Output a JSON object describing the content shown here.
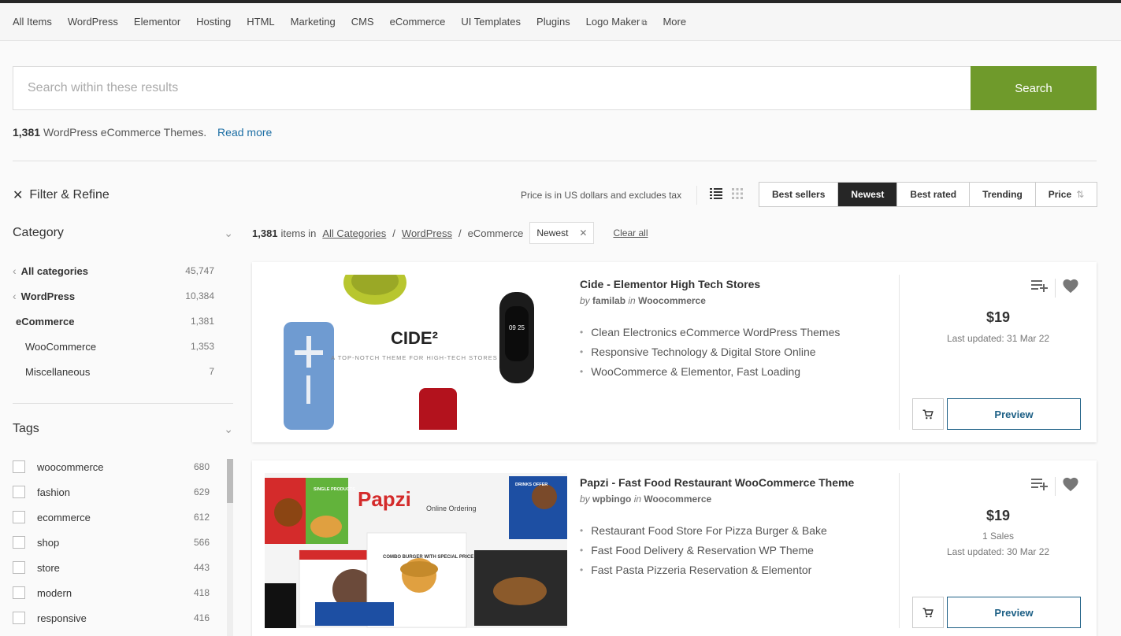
{
  "category_nav": [
    "All Items",
    "WordPress",
    "Elementor",
    "Hosting",
    "HTML",
    "Marketing",
    "CMS",
    "eCommerce",
    "UI Templates",
    "Plugins",
    "Logo Maker",
    "More"
  ],
  "search": {
    "placeholder": "Search within these results",
    "button": "Search"
  },
  "summary": {
    "count": "1,381",
    "text": "WordPress eCommerce Themes.",
    "read_more": "Read more"
  },
  "filter_refine": "Filter & Refine",
  "price_note": "Price is in US dollars and excludes tax",
  "sort": [
    "Best sellers",
    "Newest",
    "Best rated",
    "Trending",
    "Price"
  ],
  "sort_active": "Newest",
  "category": {
    "heading": "Category",
    "items": [
      {
        "label": "All categories",
        "count": "45,747"
      },
      {
        "label": "WordPress",
        "count": "10,384"
      },
      {
        "label": "eCommerce",
        "count": "1,381"
      },
      {
        "label": "WooCommerce",
        "count": "1,353"
      },
      {
        "label": "Miscellaneous",
        "count": "7"
      }
    ]
  },
  "tags": {
    "heading": "Tags",
    "items": [
      {
        "label": "woocommerce",
        "count": "680"
      },
      {
        "label": "fashion",
        "count": "629"
      },
      {
        "label": "ecommerce",
        "count": "612"
      },
      {
        "label": "shop",
        "count": "566"
      },
      {
        "label": "store",
        "count": "443"
      },
      {
        "label": "modern",
        "count": "418"
      },
      {
        "label": "responsive",
        "count": "416"
      }
    ]
  },
  "breadcrumb": {
    "count": "1,381",
    "items_in": "items in",
    "all_categories": "All Categories",
    "wordpress": "WordPress",
    "current": "eCommerce",
    "chip": "Newest",
    "clear_all": "Clear all"
  },
  "items": [
    {
      "title": "Cide - Elementor High Tech Stores",
      "by": "by",
      "author": "familab",
      "in": "in",
      "category": "Woocommerce",
      "features": [
        "Clean Electronics eCommerce WordPress Themes",
        "Responsive Technology & Digital Store Online",
        "WooCommerce & Elementor, Fast Loading"
      ],
      "price": "$19",
      "sales": "",
      "updated": "Last updated: 31 Mar 22",
      "preview": "Preview",
      "thumb_title": "CIDE²",
      "thumb_sub": "A TOP-NOTCH THEME FOR HIGH-TECH STORES",
      "thumb_clock": "09 25"
    },
    {
      "title": "Papzi - Fast Food Restaurant WooCommerce Theme",
      "by": "by",
      "author": "wpbingo",
      "in": "in",
      "category": "Woocommerce",
      "features": [
        "Restaurant Food Store For Pizza Burger & Bake",
        "Fast Food Delivery & Reservation WP Theme",
        "Fast Pasta Pizzeria Reservation & Elementor"
      ],
      "price": "$19",
      "sales": "1 Sales",
      "updated": "Last updated: 30 Mar 22",
      "preview": "Preview",
      "thumb_title": "Papzi",
      "thumb_sub": "Online Ordering",
      "thumb_single": "SINGLE PRODUCTS",
      "thumb_drinks": "DRINKS OFFER",
      "thumb_combo": "COMBO BURGER WITH SPECIAL PRICE"
    }
  ],
  "colors": {
    "accent_green": "#6f9a2b",
    "dark": "#262626",
    "link_blue": "#1c6ea4",
    "preview_blue": "#1c5f85"
  }
}
